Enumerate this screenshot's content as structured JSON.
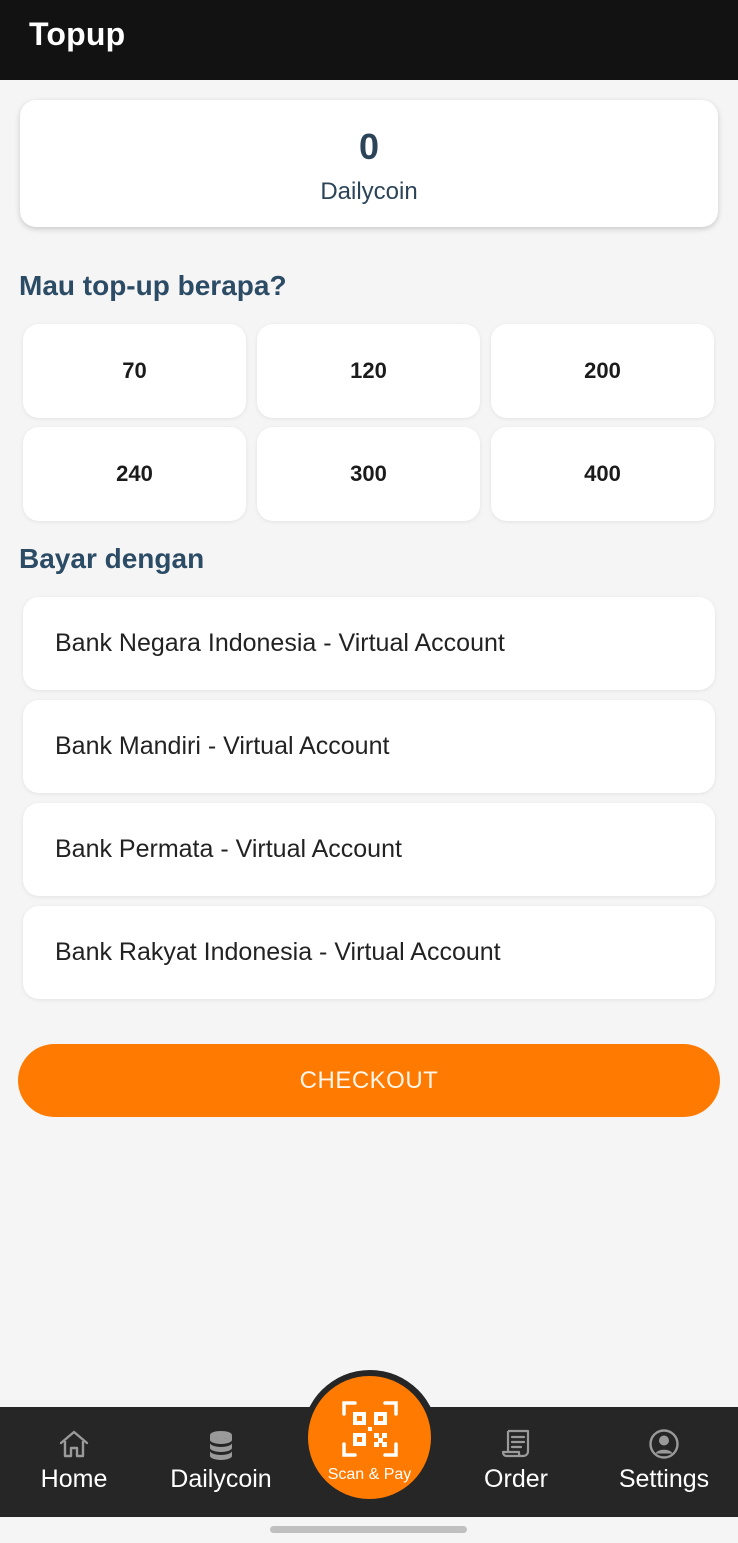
{
  "header": {
    "title": "Topup"
  },
  "balance": {
    "value": "0",
    "label": "Dailycoin"
  },
  "amount_section": {
    "title": "Mau top-up berapa?"
  },
  "amounts": [
    "70",
    "120",
    "200",
    "240",
    "300",
    "400"
  ],
  "payment_section": {
    "title": "Bayar dengan"
  },
  "payment_methods": [
    "Bank Negara Indonesia - Virtual Account",
    "Bank Mandiri - Virtual Account",
    "Bank Permata - Virtual Account",
    "Bank Rakyat Indonesia - Virtual Account"
  ],
  "checkout": {
    "label": "CHECKOUT"
  },
  "nav": {
    "home": {
      "label": "Home",
      "icon": "home-icon"
    },
    "dailycoin": {
      "label": "Dailycoin",
      "icon": "coins-icon"
    },
    "scan": {
      "label": "Scan & Pay",
      "icon": "qr-code-icon"
    },
    "order": {
      "label": "Order",
      "icon": "receipt-icon"
    },
    "settings": {
      "label": "Settings",
      "icon": "user-circle-icon"
    }
  },
  "colors": {
    "accent": "#ff7a00",
    "header_bg": "#121212",
    "nav_bg": "#262626",
    "heading_text": "#2c4c66",
    "page_bg": "#f5f5f5"
  }
}
